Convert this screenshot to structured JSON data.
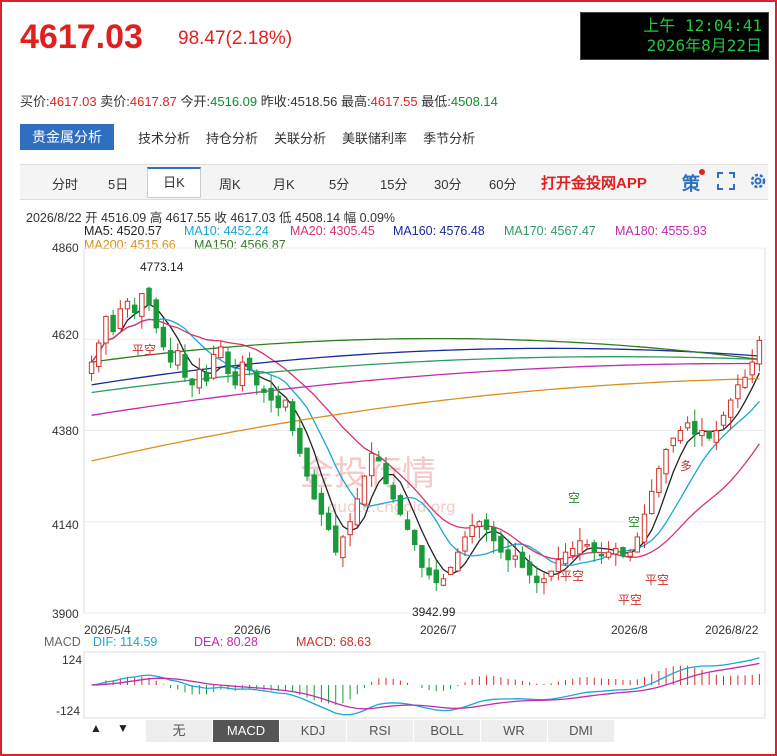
{
  "header": {
    "price": "4617.03",
    "change": "98.47(2.18%)",
    "clock_line1": "上午 12:04:41",
    "clock_line2": "2026年8月22日"
  },
  "quotes": [
    {
      "label": "买价:",
      "value": "4617.03",
      "color": "red"
    },
    {
      "label": "卖价:",
      "value": "4617.87",
      "color": "red"
    },
    {
      "label": "今开:",
      "value": "4516.09",
      "color": "green"
    },
    {
      "label": "昨收:",
      "value": "4518.56",
      "color": "black"
    },
    {
      "label": "最高:",
      "value": "4617.55",
      "color": "red"
    },
    {
      "label": "最低:",
      "value": "4508.14",
      "color": "green"
    }
  ],
  "analysis_tabs": {
    "active": "贵金属分析",
    "items": [
      "技术分析",
      "持仓分析",
      "关联分析",
      "美联储利率",
      "季节分析"
    ]
  },
  "period_tabs": {
    "items": [
      "分时",
      "5日",
      "日K",
      "周K",
      "月K",
      "5分",
      "15分",
      "30分",
      "60分"
    ],
    "selected": "日K",
    "app_link": "打开金投网APP",
    "strategy_icon_label": "策"
  },
  "ohlc_line": "2026/8/22  开 4516.09  高 4617.55  收 4617.03  低 4508.14  幅 0.09%",
  "ma_legend": [
    {
      "text": "MA5: 4520.57",
      "color": "#222222"
    },
    {
      "text": "MA10: 4452.24",
      "color": "#1aa6d6"
    },
    {
      "text": "MA20: 4305.45",
      "color": "#d6336c"
    },
    {
      "text": "MA160: 4576.48",
      "color": "#1a2a9a"
    },
    {
      "text": "MA170: 4567.47",
      "color": "#2e9a63"
    },
    {
      "text": "MA180: 4555.93",
      "color": "#c02bb0"
    },
    {
      "text": "MA200: 4515.66",
      "color": "#d9901a"
    },
    {
      "text": "MA150: 4566.87",
      "color": "#2f7d1e"
    }
  ],
  "chart_data": {
    "type": "candlestick",
    "y_ticks": [
      "4860",
      "4620",
      "4380",
      "4140",
      "3900"
    ],
    "ylim": [
      3900,
      4860
    ],
    "x_ticks": [
      "2026/5/4",
      "2026/6",
      "2026/7",
      "2026/8",
      "2026/8/22"
    ],
    "annotations": {
      "high": "4773.14",
      "low": "3942.99",
      "signals": [
        "平空",
        "空",
        "空",
        "平空",
        "平空",
        "空",
        "平空",
        "多"
      ]
    },
    "watermark": "金投行情",
    "watermark_url": "quote.cngold.org",
    "closes": [
      4560,
      4610,
      4680,
      4640,
      4700,
      4720,
      4690,
      4740,
      4710,
      4650,
      4600,
      4560,
      4590,
      4520,
      4500,
      4540,
      4510,
      4580,
      4600,
      4530,
      4500,
      4560,
      4540,
      4500,
      4480,
      4460,
      4440,
      4460,
      4380,
      4320,
      4260,
      4200,
      4160,
      4120,
      4060,
      4100,
      4140,
      4200,
      4260,
      4320,
      4300,
      4240,
      4200,
      4160,
      4120,
      4080,
      4020,
      4000,
      3980,
      3990,
      4020,
      4060,
      4100,
      4130,
      4140,
      4120,
      4090,
      4060,
      4040,
      4050,
      4020,
      4000,
      3980,
      3990,
      4010,
      4040,
      4060,
      4070,
      4090,
      4080,
      4060,
      4050,
      4060,
      4070,
      4050,
      4060,
      4100,
      4160,
      4220,
      4280,
      4330,
      4360,
      4380,
      4400,
      4370,
      4380,
      4360,
      4380,
      4420,
      4460,
      4500,
      4520,
      4560,
      4617
    ],
    "macd": {
      "dif": "DIF: 114.59",
      "dea": "DEA: 80.28",
      "macd": "MACD: 68.63",
      "y_ticks": [
        "124",
        "-124"
      ],
      "ylim": [
        -124,
        124
      ]
    }
  },
  "indicator_tabs": {
    "items": [
      "无",
      "MACD",
      "KDJ",
      "RSI",
      "BOLL",
      "WR",
      "DMI"
    ],
    "selected": "MACD",
    "up": "▲",
    "down": "▼"
  }
}
